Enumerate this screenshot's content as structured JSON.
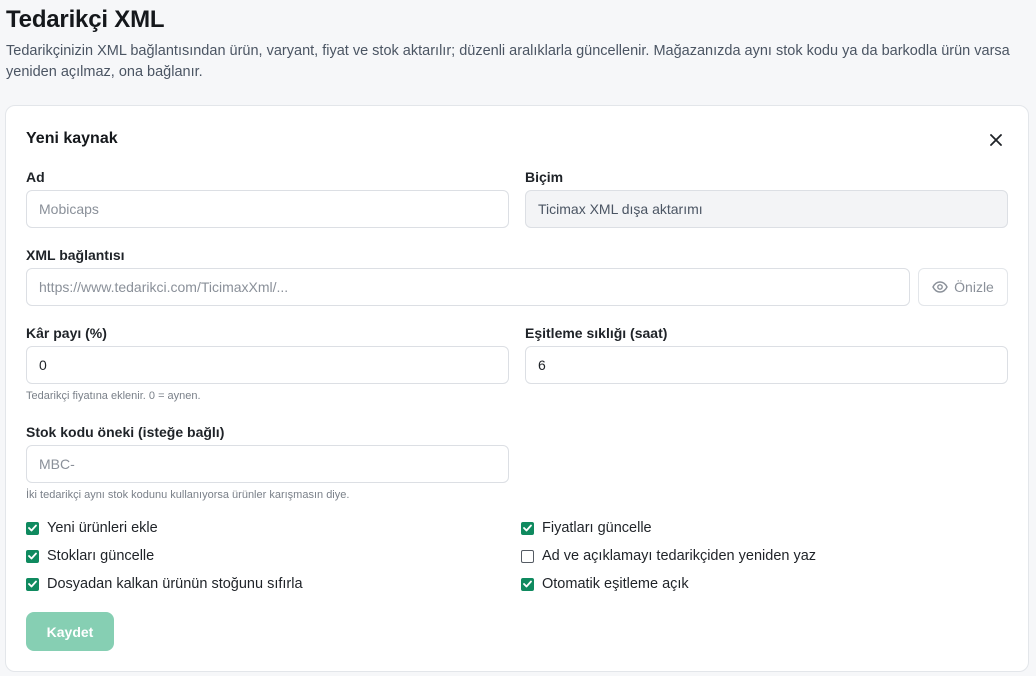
{
  "page": {
    "title": "Tedarikçi XML",
    "description": "Tedarikçinizin XML bağlantısından ürün, varyant, fiyat ve stok aktarılır; düzenli aralıklarla güncellenir. Mağazanızda aynı stok kodu ya da barkodla ürün varsa yeniden açılmaz, ona bağlanır."
  },
  "card": {
    "title": "Yeni kaynak",
    "close_icon": "close-icon"
  },
  "form": {
    "name": {
      "label": "Ad",
      "placeholder": "Mobicaps",
      "value": ""
    },
    "format": {
      "label": "Biçim",
      "value": "Ticimax XML dışa aktarımı"
    },
    "xml_url": {
      "label": "XML bağlantısı",
      "placeholder": "https://www.tedarikci.com/TicimaxXml/...",
      "value": ""
    },
    "preview": {
      "label": "Önizle",
      "icon": "eye-icon"
    },
    "margin": {
      "label": "Kâr payı (%)",
      "value": "0",
      "hint": "Tedarikçi fiyatına eklenir. 0 = aynen."
    },
    "sync_freq": {
      "label": "Eşitleme sıklığı (saat)",
      "value": "6"
    },
    "sku_prefix": {
      "label": "Stok kodu öneki (isteğe bağlı)",
      "placeholder": "MBC-",
      "value": "",
      "hint": "İki tedarikçi aynı stok kodunu kullanıyorsa ürünler karışmasın diye."
    }
  },
  "options": [
    {
      "label": "Yeni ürünleri ekle",
      "checked": true
    },
    {
      "label": "Fiyatları güncelle",
      "checked": true
    },
    {
      "label": "Stokları güncelle",
      "checked": true
    },
    {
      "label": "Ad ve açıklamayı tedarikçiden yeniden yaz",
      "checked": false
    },
    {
      "label": "Dosyadan kalkan ürünün stoğunu sıfırla",
      "checked": true
    },
    {
      "label": "Otomatik eşitleme açık",
      "checked": true
    }
  ],
  "actions": {
    "save_label": "Kaydet"
  },
  "colors": {
    "accent": "#0f8a5f",
    "save_button_disabled": "#86cfb3"
  }
}
